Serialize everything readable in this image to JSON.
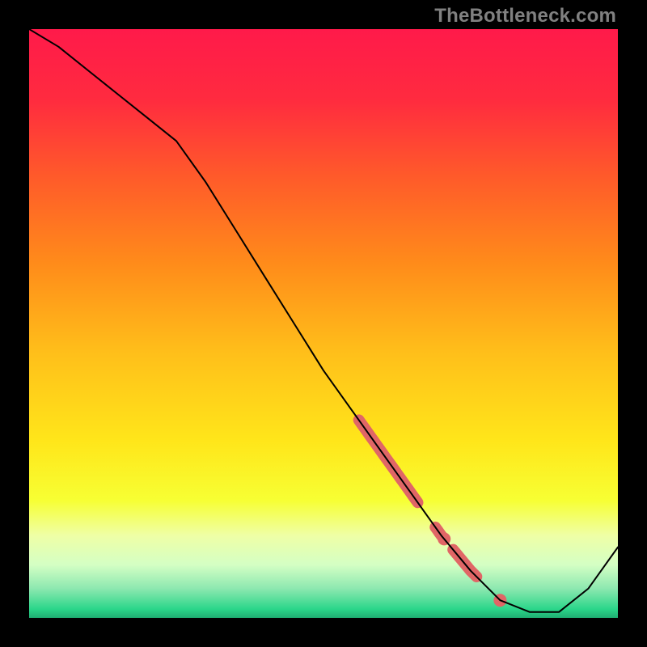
{
  "watermark": "TheBottleneck.com",
  "chart_data": {
    "type": "line",
    "title": "",
    "xlabel": "",
    "ylabel": "",
    "xlim": [
      0,
      100
    ],
    "ylim": [
      0,
      100
    ],
    "x": [
      0,
      5,
      10,
      15,
      20,
      25,
      30,
      35,
      40,
      45,
      50,
      55,
      60,
      65,
      70,
      75,
      80,
      85,
      90,
      95,
      100
    ],
    "values": [
      100,
      97,
      93,
      89,
      85,
      81,
      74,
      66,
      58,
      50,
      42,
      35,
      28,
      21,
      14,
      8,
      3,
      1,
      1,
      5,
      12
    ],
    "gradient_stops": [
      {
        "offset": 0.0,
        "color": "#ff1a4a"
      },
      {
        "offset": 0.12,
        "color": "#ff2b3f"
      },
      {
        "offset": 0.25,
        "color": "#ff5a2a"
      },
      {
        "offset": 0.4,
        "color": "#ff8c1a"
      },
      {
        "offset": 0.55,
        "color": "#ffbf1a"
      },
      {
        "offset": 0.7,
        "color": "#ffe61a"
      },
      {
        "offset": 0.8,
        "color": "#f7ff33"
      },
      {
        "offset": 0.86,
        "color": "#efffa6"
      },
      {
        "offset": 0.91,
        "color": "#d4ffc4"
      },
      {
        "offset": 0.95,
        "color": "#8de8b0"
      },
      {
        "offset": 0.985,
        "color": "#2bd68a"
      },
      {
        "offset": 1.0,
        "color": "#1fae72"
      }
    ],
    "highlight_segments": [
      {
        "x0": 56,
        "x1": 66
      },
      {
        "x0": 69,
        "x1": 70.5
      },
      {
        "x0": 72,
        "x1": 76
      }
    ],
    "highlight_dots_x": [
      70.5,
      80
    ],
    "marker_color": "#e06666",
    "curve_color": "#000000"
  }
}
